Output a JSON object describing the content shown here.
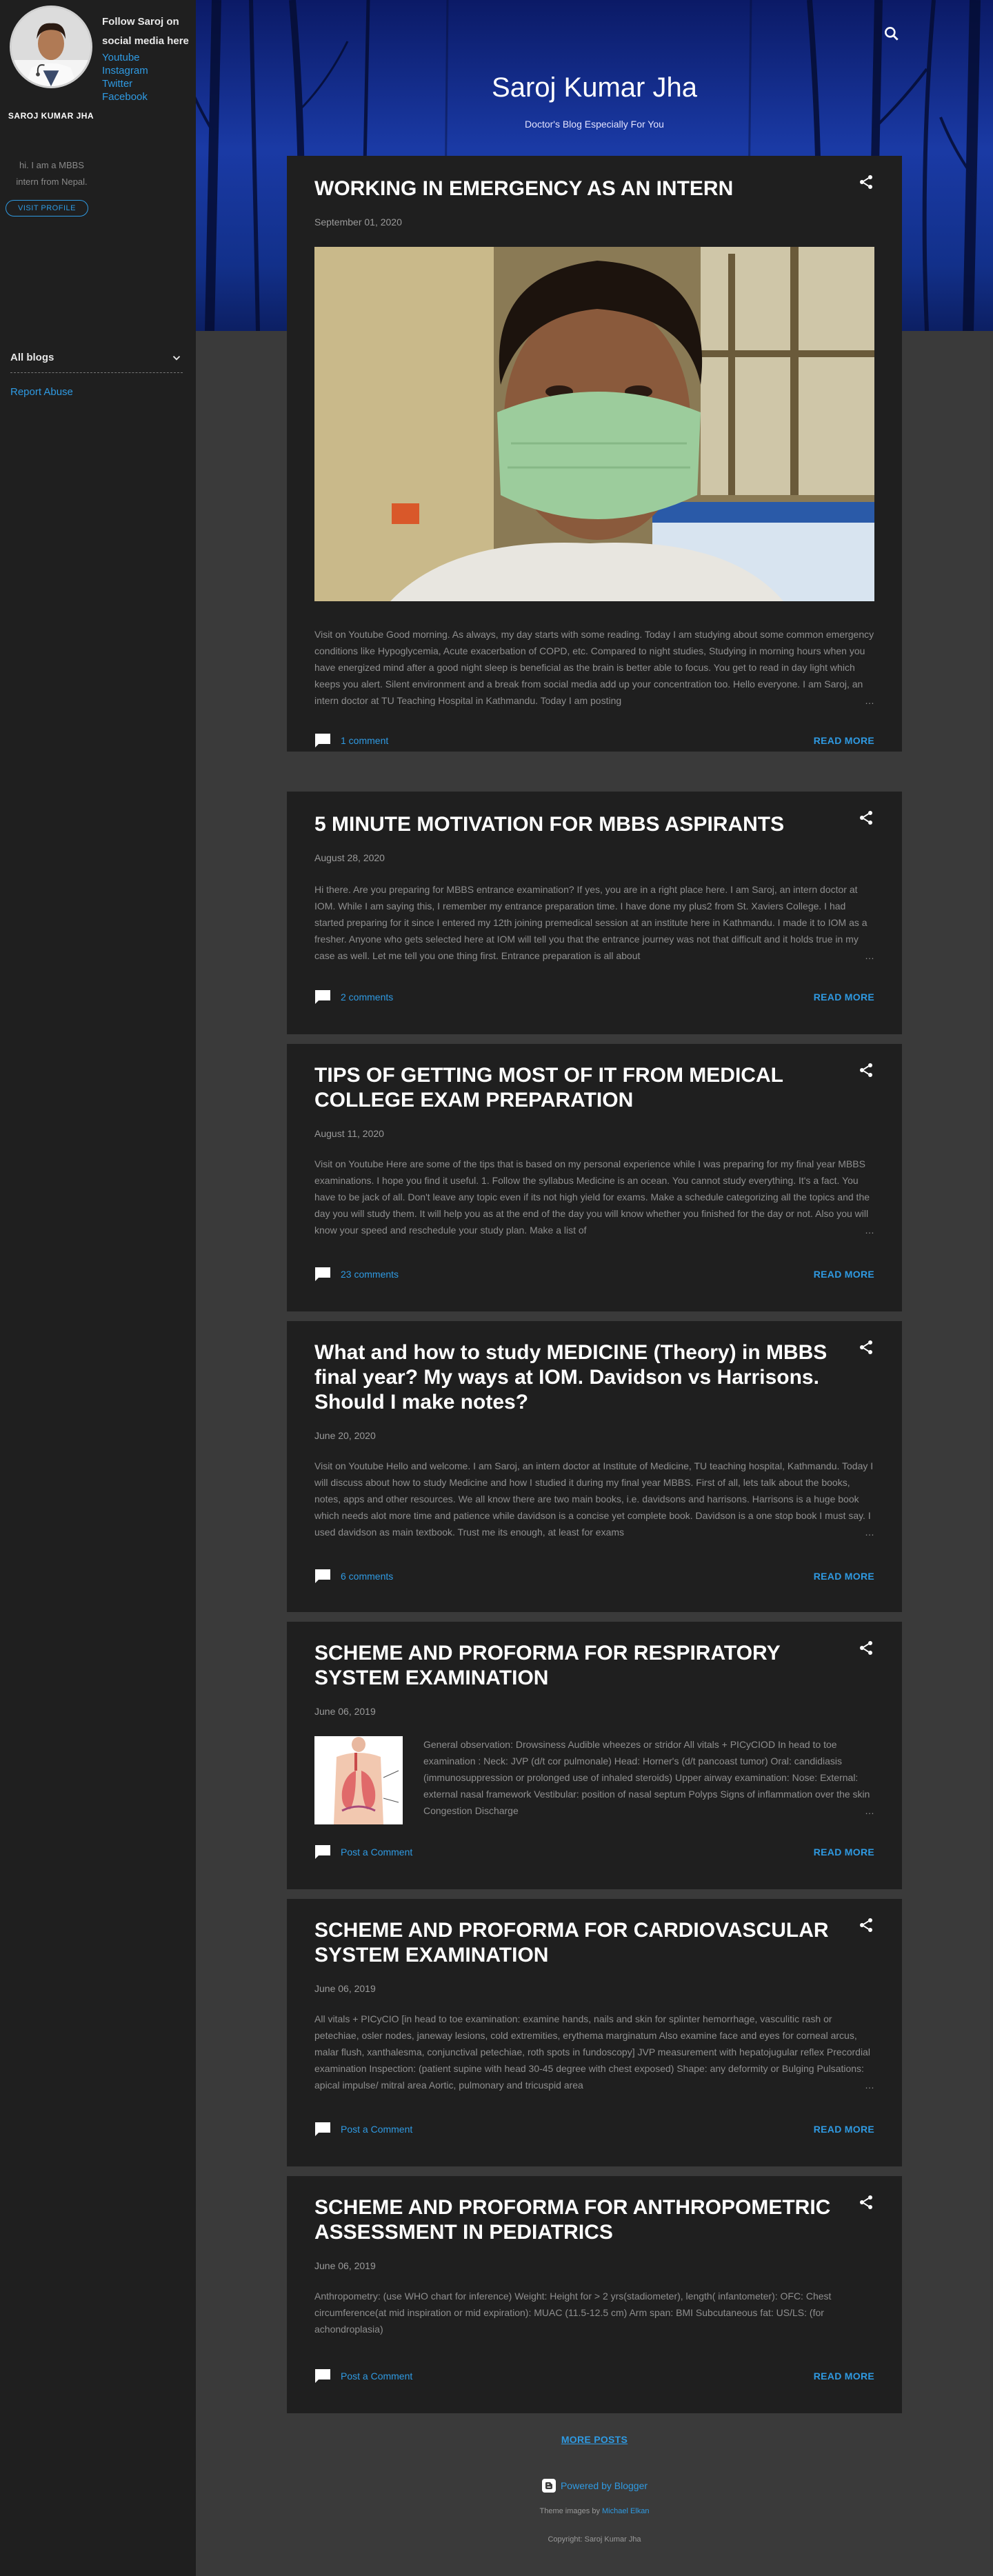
{
  "sidebar": {
    "profile_name": "SAROJ KUMAR JHA",
    "follow_title": "Follow Saroj on social media here",
    "social_links": [
      "Youtube",
      "Instagram",
      "Twitter",
      "Facebook"
    ],
    "bio": "hi. I am a MBBS intern from Nepal.",
    "visit_profile": "VISIT PROFILE",
    "all_blogs": "All blogs",
    "report_abuse": "Report Abuse"
  },
  "header": {
    "title": "Saroj Kumar Jha",
    "subtitle": "Doctor's Blog Especially For You"
  },
  "posts": [
    {
      "title": "WORKING IN EMERGENCY AS AN INTERN",
      "date": "September 01, 2020",
      "snippet": "Visit on Youtube Good morning. As always, my day starts with some reading. Today I am studying about some common emergency conditions like Hypoglycemia, Acute exacerbation of COPD, etc. Compared to night studies, Studying in morning hours when you have energized mind after a good night sleep is beneficial as the brain is better able to focus. You get to read in day light which keeps you alert. Silent environment and a break from social media add up your concentration too. Hello everyone. I am Saroj, an intern doctor at TU Teaching Hospital in Kathmandu. Today I am posting",
      "comments": "1 comment",
      "read_more": "READ MORE"
    },
    {
      "title": "5 MINUTE MOTIVATION FOR MBBS ASPIRANTS",
      "date": "August 28, 2020",
      "snippet": " Hi there. Are you preparing for MBBS entrance examination? If yes, you are in a right place here. I am Saroj, an intern doctor at IOM. While I am saying this, I remember my entrance preparation time. I have done my plus2 from St. Xaviers College.  I had started preparing for it since I entered my 12th joining premedical session at an institute here in Kathmandu. I made it to IOM as a fresher. Anyone who gets selected here at IOM will tell you that the entrance journey was not that difficult and it holds true in my case as well. Let me tell you one thing first. Entrance preparation is all about",
      "comments": "2 comments",
      "read_more": "READ MORE"
    },
    {
      "title": "TIPS OF GETTING MOST OF IT FROM MEDICAL COLLEGE EXAM PREPARATION",
      "date": "August 11, 2020",
      "snippet": "Visit on Youtube Here are some of the tips that is based on my personal experience while I was preparing for my final year MBBS examinations. I hope you find it useful.  1. Follow the syllabus Medicine is an ocean. You cannot study everything. It's a fact. You have to be jack of all. Don't leave any topic even if its not high yield for exams. Make a schedule categorizing all the topics and the day you will study them. It will help you as at the end of the day you will know whether you finished for the day or not. Also you will know your speed and reschedule your study plan. Make a list of",
      "comments": "23 comments",
      "read_more": "READ MORE"
    },
    {
      "title": "What and how to study MEDICINE (Theory) in MBBS final year? My ways at IOM. Davidson vs Harrisons. Should I make notes?",
      "date": "June 20, 2020",
      "snippet": "Visit on Youtube Hello and welcome. I am Saroj, an intern doctor at Institute of Medicine, TU teaching hospital, Kathmandu. Today I will discuss about how to study Medicine and how I studied it during my final year MBBS. First of all, lets talk about the books, notes, apps and other resources. We all know there are two main books, i.e. davidsons and harrisons. Harrisons is a huge book which needs alot more time and patience while davidson is a concise yet complete book. Davidson is a one stop book I must say. I used davidson as main textbook. Trust me its enough, at least for exams",
      "comments": "6 comments",
      "read_more": "READ MORE"
    },
    {
      "title": "SCHEME AND PROFORMA FOR RESPIRATORY SYSTEM EXAMINATION",
      "date": "June 06, 2019",
      "snippet": "General observation: Drowsiness                                    Audible wheezes or stridor All vitals + PICyCIOD In head to toe examination : Neck: JVP (d/t cor pulmonale) Head: Horner's (d/t pancoast tumor) Oral: candidiasis (immunosuppression or prolonged use of inhaled steroids) Upper airway examination: Nose:                      External: external nasal framework             Vestibular: position of nasal septum Polyps Signs of inflammation over the skin Congestion Discharge",
      "comments": "Post a Comment",
      "read_more": "READ MORE"
    },
    {
      "title": "SCHEME AND PROFORMA FOR CARDIOVASCULAR SYSTEM EXAMINATION",
      "date": "June 06, 2019",
      "snippet": "All vitals + PICyCIO [in head to toe examination: examine hands, nails and skin for splinter hemorrhage, vasculitic rash or petechiae, osler nodes, janeway lesions, cold extremities, erythema marginatum Also examine face and eyes for corneal arcus, malar flush, xanthalesma, conjunctival petechiae, roth spots in fundoscopy] JVP measurement with hepatojugular reflex Precordial examination Inspection: (patient supine with head 30-45 degree with chest exposed) Shape: any deformity or Bulging Pulsations: apical impulse/ mitral area                  Aortic, pulmonary and tricuspid area",
      "comments": "Post a Comment",
      "read_more": "READ MORE"
    },
    {
      "title": "SCHEME AND PROFORMA FOR ANTHROPOMETRIC ASSESSMENT IN PEDIATRICS",
      "date": "June 06, 2019",
      "snippet": "Anthropometry: (use WHO chart for inference) Weight: Height for > 2 yrs(stadiometer), length( infantometer): OFC: Chest circumference(at mid inspiration or mid expiration): MUAC (11.5-12.5 cm) Arm span: BMI Subcutaneous fat: US/LS: (for achondroplasia)",
      "comments": "Post a Comment",
      "read_more": "READ MORE"
    }
  ],
  "footer": {
    "more_posts": "MORE POSTS",
    "powered_by": "Powered by Blogger",
    "theme_prefix": "Theme images by ",
    "theme_author": "Michael Elkan",
    "copyright": "Copyright: Saroj Kumar Jha"
  },
  "colors": {
    "accent": "#2f9ae2",
    "card": "#1f1f1f",
    "page": "#3a3a3a"
  }
}
